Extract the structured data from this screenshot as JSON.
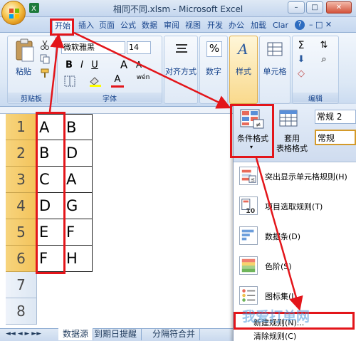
{
  "window": {
    "title": "相同不同.xlsm - Microsoft Excel"
  },
  "tabs": [
    "开始",
    "插入",
    "页面",
    "公式",
    "数据",
    "审阅",
    "视图",
    "开发",
    "办公",
    "加载",
    "Clar"
  ],
  "ribbon": {
    "font_name": "微软雅黑",
    "font_size": "14",
    "paste_label": "粘贴",
    "clipboard_label": "剪贴板",
    "font_group_label": "字体",
    "align_label": "对齐方式",
    "number_label": "数字",
    "styles_label": "样式",
    "cells_label": "单元格",
    "edit_label": "编辑",
    "bold": "B",
    "italic": "I",
    "underline": "U",
    "grow_font": "A",
    "shrink_font": "A",
    "font_color": "A",
    "percent": "%",
    "wen": "wén"
  },
  "sheet": {
    "rows": [
      "1",
      "2",
      "3",
      "4",
      "5",
      "6",
      "7",
      "8"
    ],
    "colA": [
      "A",
      "B",
      "C",
      "D",
      "E",
      "F"
    ],
    "colB": [
      "B",
      "D",
      "A",
      "G",
      "F",
      "H"
    ],
    "sheet_tabs": [
      "数据源",
      "到期日提醒",
      "分隔符合并"
    ]
  },
  "dropdown": {
    "cond_format_label": "条件格式",
    "table_format_label": "套用\n表格格式",
    "style_box1": "常规 2",
    "style_box2": "常规",
    "items": [
      "突出显示单元格规则(H)",
      "项目选取规则(T)",
      "数据条(D)",
      "色阶(S)",
      "图标集(I)",
      "新建规则(N)...",
      "清除规则(C)"
    ]
  },
  "watermark": "我爱打单网",
  "colors": {
    "highlight": "#e3151a",
    "row_header": "#f3c35a",
    "ribbon": "#dbe7f5"
  }
}
